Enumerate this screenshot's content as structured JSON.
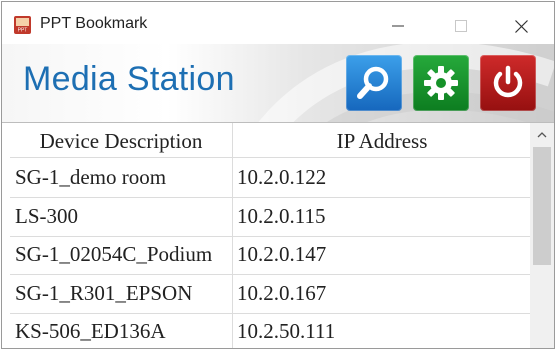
{
  "window": {
    "title": "PPT Bookmark",
    "app_icon_text": "PPT"
  },
  "header": {
    "title": "Media Station",
    "buttons": [
      "search",
      "settings",
      "power"
    ]
  },
  "table": {
    "columns": [
      "Device Description",
      "IP Address"
    ],
    "rows": [
      {
        "description": "SG-1_demo room",
        "ip": "10.2.0.122"
      },
      {
        "description": "LS-300",
        "ip": "10.2.0.115"
      },
      {
        "description": "SG-1_02054C_Podium",
        "ip": "10.2.0.147"
      },
      {
        "description": "SG-1_R301_EPSON",
        "ip": "10.2.0.167"
      },
      {
        "description": "KS-506_ED136A",
        "ip": "10.2.50.111"
      }
    ]
  },
  "icons": {
    "app": "presentation-app-icon",
    "minimize": "minimize-icon",
    "maximize": "maximize-icon",
    "close": "close-icon",
    "search": "magnifier-icon",
    "settings": "gear-icon",
    "power": "power-icon",
    "scroll_up": "chevron-up-icon"
  },
  "colors": {
    "title_blue": "#1d6fb3",
    "search_button": "#1f78cf",
    "settings_button": "#179a2c",
    "power_button": "#b51c1c"
  }
}
